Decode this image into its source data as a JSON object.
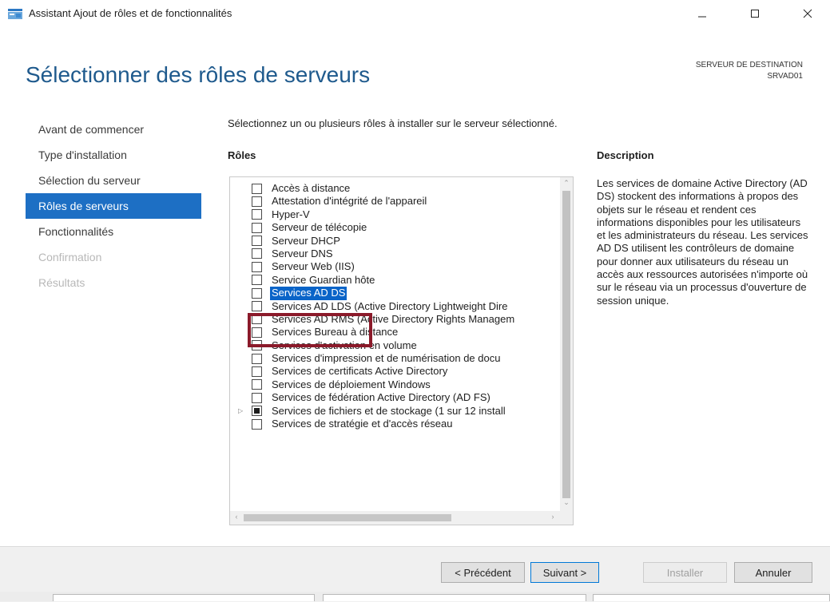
{
  "window": {
    "title": "Assistant Ajout de rôles et de fonctionnalités"
  },
  "header": {
    "page_title": "Sélectionner des rôles de serveurs",
    "destination_label": "SERVEUR DE DESTINATION",
    "destination_server": "SRVAD01"
  },
  "nav": {
    "items": [
      {
        "label": "Avant de commencer",
        "state": "normal"
      },
      {
        "label": "Type d'installation",
        "state": "normal"
      },
      {
        "label": "Sélection du serveur",
        "state": "normal"
      },
      {
        "label": "Rôles de serveurs",
        "state": "active"
      },
      {
        "label": "Fonctionnalités",
        "state": "normal"
      },
      {
        "label": "Confirmation",
        "state": "disabled"
      },
      {
        "label": "Résultats",
        "state": "disabled"
      }
    ]
  },
  "main": {
    "instruction": "Sélectionnez un ou plusieurs rôles à installer sur le serveur sélectionné.",
    "roles_heading": "Rôles",
    "roles": [
      {
        "label": "Accès à distance",
        "checked": false
      },
      {
        "label": "Attestation d'intégrité de l'appareil",
        "checked": false
      },
      {
        "label": "Hyper-V",
        "checked": false
      },
      {
        "label": "Serveur de télécopie",
        "checked": false
      },
      {
        "label": "Serveur DHCP",
        "checked": false
      },
      {
        "label": "Serveur DNS",
        "checked": false
      },
      {
        "label": "Serveur Web (IIS)",
        "checked": false
      },
      {
        "label": "Service Guardian hôte",
        "checked": false
      },
      {
        "label": "Services AD DS",
        "checked": false,
        "selected": true
      },
      {
        "label": "Services AD LDS (Active Directory Lightweight Dire",
        "checked": false
      },
      {
        "label": "Services AD RMS (Active Directory Rights Managem",
        "checked": false
      },
      {
        "label": "Services Bureau à distance",
        "checked": false
      },
      {
        "label": "Services d'activation en volume",
        "checked": false
      },
      {
        "label": "Services d'impression et de numérisation de docu",
        "checked": false
      },
      {
        "label": "Services de certificats Active Directory",
        "checked": false
      },
      {
        "label": "Services de déploiement Windows",
        "checked": false
      },
      {
        "label": "Services de fédération Active Directory (AD FS)",
        "checked": false
      },
      {
        "label": "Services de fichiers et de stockage (1 sur 12 install",
        "checked": "partial",
        "expandable": true
      },
      {
        "label": "Services de stratégie et d'accès réseau",
        "checked": false
      }
    ],
    "description_heading": "Description",
    "description_text": "Les services de domaine Active Directory (AD DS) stockent des informations à propos des objets sur le réseau et rendent ces informations disponibles pour les utilisateurs et les administrateurs du réseau. Les services AD DS utilisent les contrôleurs de domaine pour donner aux utilisateurs du réseau un accès aux ressources autorisées n'importe où sur le réseau via un processus d'ouverture de session unique."
  },
  "footer": {
    "previous_label": "< Précédent",
    "next_label": "Suivant >",
    "install_label": "Installer",
    "cancel_label": "Annuler"
  },
  "colors": {
    "accent": "#1d6fc4",
    "title_blue": "#1f5a8d",
    "highlight_box": "#8b1a2a",
    "selection": "#0a64c8"
  },
  "icons": {
    "app": "server-manager-icon",
    "minimize": "minimize-icon",
    "maximize": "maximize-icon",
    "close": "close-icon"
  }
}
